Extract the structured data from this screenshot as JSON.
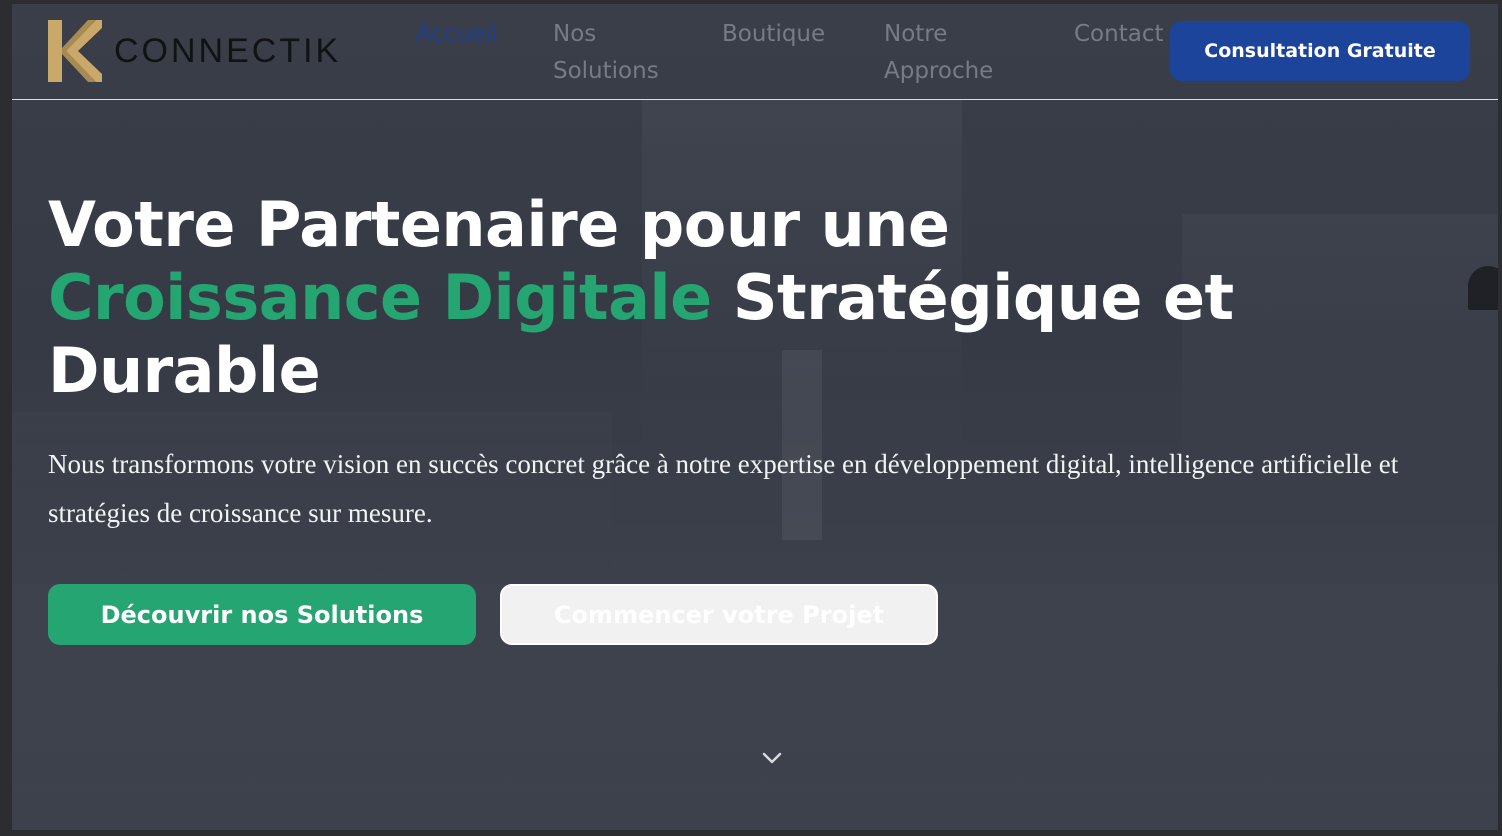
{
  "header": {
    "logo_text": "CONNECTIK",
    "nav": [
      {
        "label": "Accueil",
        "active": true
      },
      {
        "label": "Nos Solutions",
        "active": false
      },
      {
        "label": "Boutique",
        "active": false
      },
      {
        "label": "Notre Approche",
        "active": false
      },
      {
        "label": "Contact",
        "active": false
      }
    ],
    "cta_label": "Consultation Gratuite"
  },
  "hero": {
    "title_line1": "Votre Partenaire pour une",
    "title_accent": "Croissance Digitale",
    "title_line2_rest": "Stratégique et",
    "title_line3": "Durable",
    "subtitle": "Nous transformons votre vision en succès concret grâce à notre expertise en développement digital, intelligence artificielle et stratégies de croissance sur mesure.",
    "primary_button": "Découvrir nos Solutions",
    "secondary_button": "Commencer votre Projet"
  },
  "icons": {
    "logo": "connectik-k-logo-icon",
    "scroll": "chevron-down-icon"
  },
  "colors": {
    "brand_gold": "#c9a86a",
    "accent_green": "#24a571",
    "cta_blue": "#1d449b",
    "nav_active": "#1e3f8f"
  }
}
